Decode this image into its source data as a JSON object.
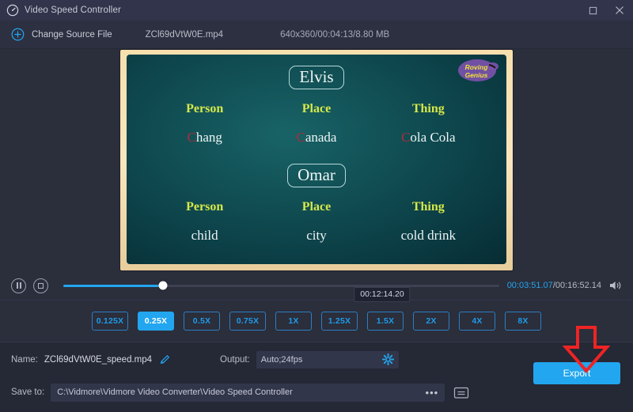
{
  "window": {
    "title": "Video Speed Controller",
    "app_icon": "speedometer-icon",
    "maximize_label": "Maximize",
    "close_label": "Close"
  },
  "source_bar": {
    "change_source_label": "Change Source File",
    "plus_icon": "plus-circle-icon",
    "file_name": "ZCl69dVtW0E.mp4",
    "file_meta": "640x360/00:04:13/8.80 MB"
  },
  "video": {
    "slide1": {
      "name": "Elvis",
      "headers": [
        "Person",
        "Place",
        "Thing"
      ],
      "values": [
        "Chang",
        "Canada",
        "Cola Cola"
      ],
      "value_initials": [
        "C",
        "C",
        "C"
      ],
      "value_rest": [
        "hang",
        "anada",
        "ola Cola"
      ]
    },
    "slide2": {
      "name": "Omar",
      "headers": [
        "Person",
        "Place",
        "Thing"
      ],
      "values": [
        "child",
        "city",
        "cold drink"
      ]
    },
    "watermark_line1": "Roving",
    "watermark_line2": "Genius",
    "header_color": "#d6e84a",
    "initial_color": "#b22b3a"
  },
  "transport": {
    "pause_icon": "pause-icon",
    "stop_icon": "stop-icon",
    "progress_percent": 22.8,
    "current_time": "00:03:51.07",
    "time_separator": "/",
    "total_time": "00:16:52.14",
    "volume_icon": "speaker-icon",
    "hover_tooltip": "00:12:14.20",
    "accent_color": "#22a6ef"
  },
  "speeds": {
    "options": [
      "0.125X",
      "0.25X",
      "0.5X",
      "0.75X",
      "1X",
      "1.25X",
      "1.5X",
      "2X",
      "4X",
      "8X"
    ],
    "selected": "0.25X"
  },
  "bottom": {
    "name_label": "Name:",
    "name_value": "ZCl69dVtW0E_speed.mp4",
    "edit_icon": "pencil-icon",
    "output_label": "Output:",
    "output_value": "Auto;24fps",
    "settings_icon": "gear-icon",
    "save_to_label": "Save to:",
    "save_to_path": "C:\\Vidmore\\Vidmore Video Converter\\Video Speed Controller",
    "browse_dots": "•••",
    "folder_icon": "folder-icon",
    "export_label": "Export",
    "annotation_arrow": "red-down-arrow",
    "annotation_color": "#ee2424"
  }
}
